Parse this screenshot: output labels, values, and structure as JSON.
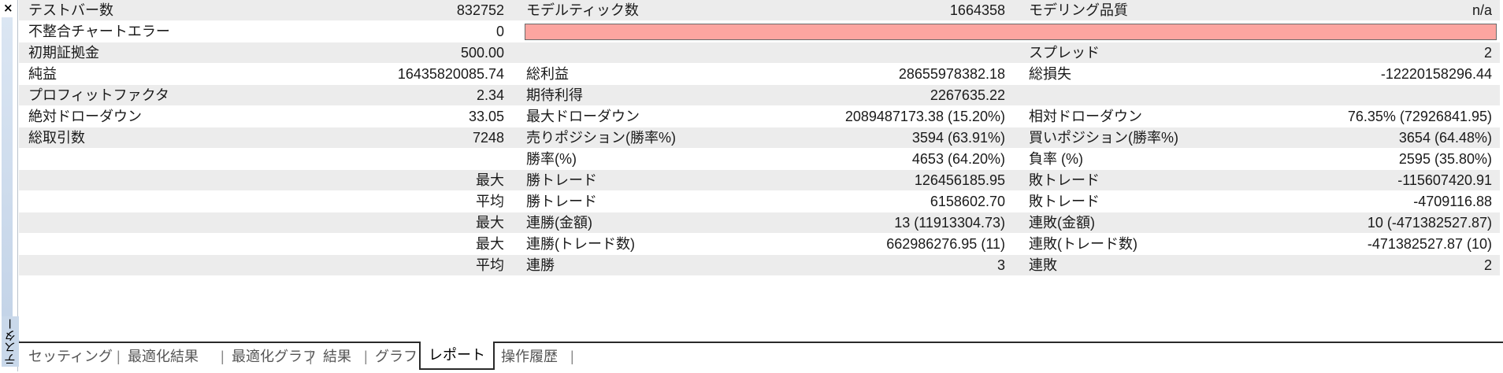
{
  "window": {
    "side_title": "テスター",
    "close_glyph": "×"
  },
  "rows": [
    {
      "l1": "テストバー数",
      "v1": "832752",
      "l2": "モデルティック数",
      "v2": "1664358",
      "l3": "モデリング品質",
      "v3": "n/a"
    },
    {
      "l1": "不整合チャートエラー",
      "v1": "0",
      "l2": "",
      "v2": "",
      "l3": "",
      "v3": ""
    },
    {
      "l1": "初期証拠金",
      "v1": "500.00",
      "l2": "",
      "v2": "",
      "l3": "スプレッド",
      "v3": "2"
    },
    {
      "l1": "純益",
      "v1": "16435820085.74",
      "l2": "総利益",
      "v2": "28655978382.18",
      "l3": "総損失",
      "v3": "-12220158296.44"
    },
    {
      "l1": "プロフィットファクタ",
      "v1": "2.34",
      "l2": "期待利得",
      "v2": "2267635.22",
      "l3": "",
      "v3": ""
    },
    {
      "l1": "絶対ドローダウン",
      "v1": "33.05",
      "l2": "最大ドローダウン",
      "v2": "2089487173.38 (15.20%)",
      "l3": "相対ドローダウン",
      "v3": "76.35% (72926841.95)"
    },
    {
      "l1": "総取引数",
      "v1": "7248",
      "l2": "売りポジション(勝率%)",
      "v2": "3594 (63.91%)",
      "l3": "買いポジション(勝率%)",
      "v3": "3654 (64.48%)"
    },
    {
      "l1": "",
      "v1": "",
      "l2": "勝率(%)",
      "v2": "4653 (64.20%)",
      "l3": "負率 (%)",
      "v3": "2595 (35.80%)"
    },
    {
      "l1": "",
      "v1": "最大",
      "l2": "勝トレード",
      "v2": "126456185.95",
      "l3": "敗トレード",
      "v3": "-115607420.91"
    },
    {
      "l1": "",
      "v1": "平均",
      "l2": "勝トレード",
      "v2": "6158602.70",
      "l3": "敗トレード",
      "v3": "-4709116.88"
    },
    {
      "l1": "",
      "v1": "最大",
      "l2": "連勝(金額)",
      "v2": "13 (11913304.73)",
      "l3": "連敗(金額)",
      "v3": "10 (-471382527.87)"
    },
    {
      "l1": "",
      "v1": "最大",
      "l2": "連勝(トレード数)",
      "v2": "662986276.95 (11)",
      "l3": "連敗(トレード数)",
      "v3": "-471382527.87 (10)"
    },
    {
      "l1": "",
      "v1": "平均",
      "l2": "連勝",
      "v2": "3",
      "l3": "連敗",
      "v3": "2"
    }
  ],
  "tabs": {
    "settings": "セッティング",
    "opt_results": "最適化結果",
    "opt_graph": "最適化グラフ",
    "results": "結果",
    "graph": "グラフ",
    "report": "レポート",
    "journal": "操作履歴",
    "separator": "|"
  },
  "colors": {
    "error_bar": "#fca5a0",
    "row_shade": "#ececec"
  }
}
